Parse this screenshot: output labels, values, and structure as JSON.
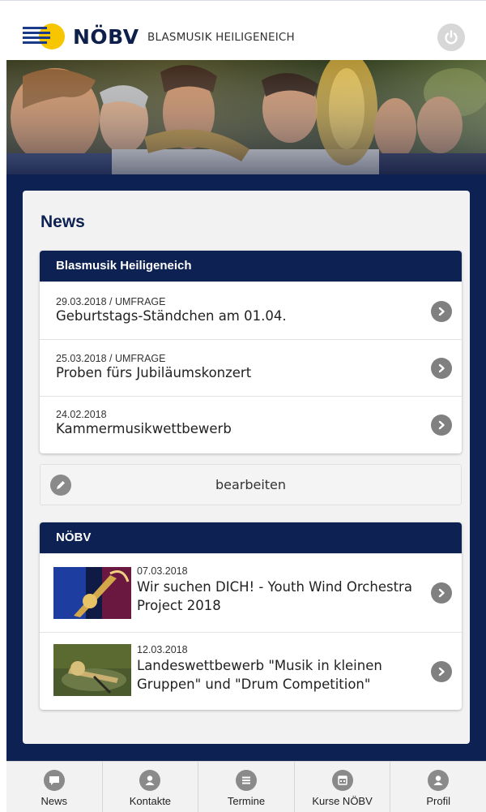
{
  "header": {
    "brand": "NÖBV",
    "subtitle": "BLASMUSIK HEILIGENEICH",
    "logo_colors": {
      "stripes": "#1b3a8a",
      "circle": "#f7c600"
    }
  },
  "banner": {
    "image": "brass-band-photo"
  },
  "news": {
    "title": "News",
    "local": {
      "heading": "Blasmusik Heiligeneich",
      "items": [
        {
          "meta": "29.03.2018 / UMFRAGE",
          "title": "Geburtstags-Ständchen am 01.04."
        },
        {
          "meta": "25.03.2018 / UMFRAGE",
          "title": "Proben fürs Jubiläumskonzert"
        },
        {
          "meta": "24.02.2018",
          "title": "Kammermusikwettbewerb"
        }
      ],
      "edit_label": "bearbeiten"
    },
    "noebv": {
      "heading": "NÖBV",
      "items": [
        {
          "meta": "07.03.2018",
          "title_line1": "Wir suchen DICH! - Youth Wind Orchestra",
          "title_line2": "Project 2018"
        },
        {
          "meta": "12.03.2018",
          "title_line1": "Landeswettbewerb \"Musik in kleinen",
          "title_line2": "Gruppen\" und \"Drum Competition\""
        }
      ]
    }
  },
  "nav": [
    {
      "label": "News",
      "icon": "speech-bubble-icon"
    },
    {
      "label": "Kontakte",
      "icon": "person-icon"
    },
    {
      "label": "Termine",
      "icon": "list-icon"
    },
    {
      "label": "Kurse NÖBV",
      "icon": "calendar-icon"
    },
    {
      "label": "Profil",
      "icon": "person-icon"
    }
  ],
  "colors": {
    "navy": "#0d2152",
    "panel_bg": "#f2f2f2",
    "icon_gray": "#808080"
  }
}
